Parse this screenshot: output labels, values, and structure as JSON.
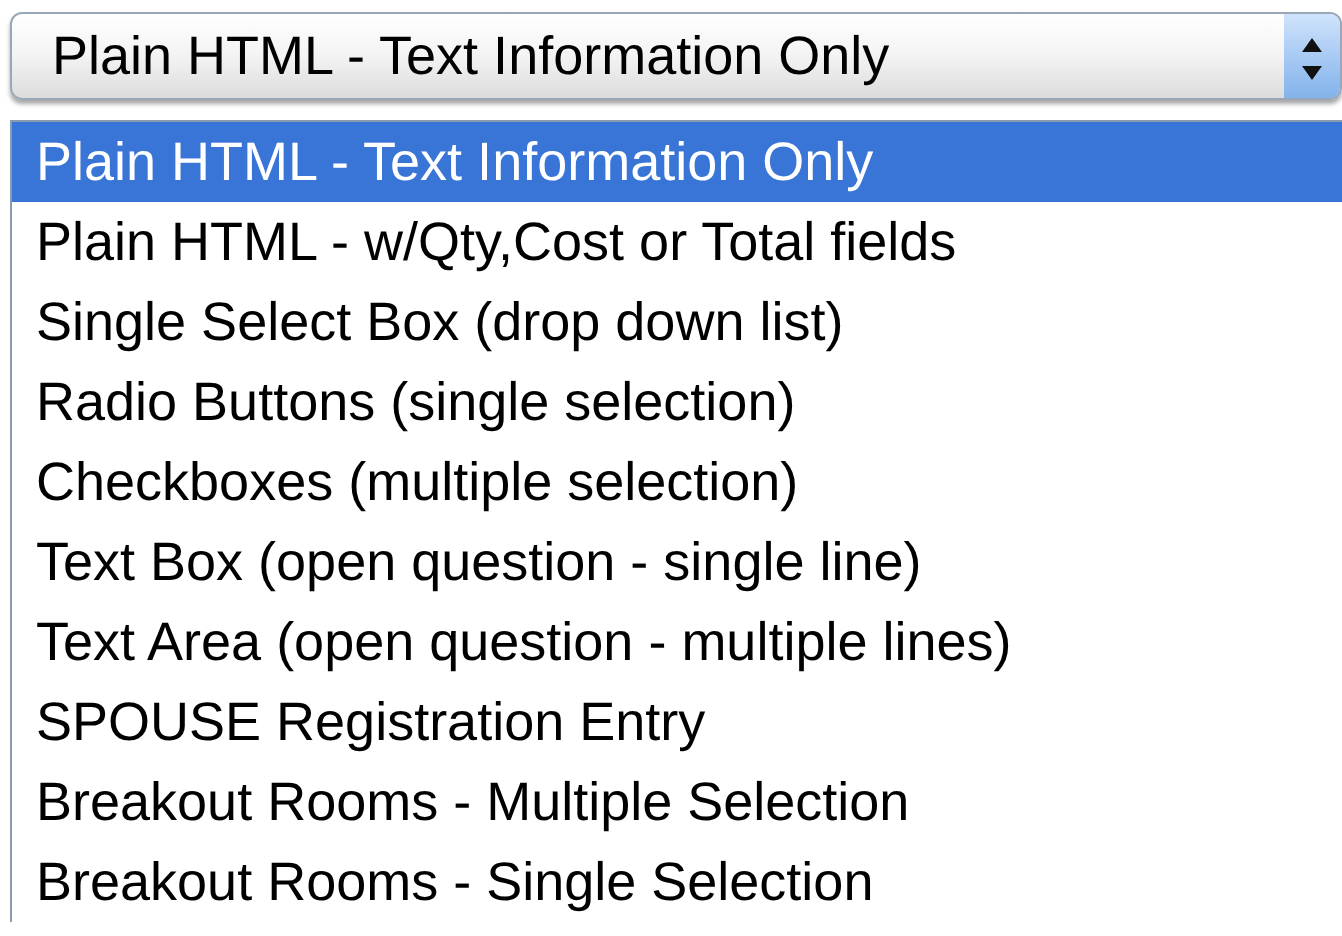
{
  "select": {
    "value": "Plain HTML - Text Information Only"
  },
  "options": [
    {
      "label": "Plain HTML - Text Information Only",
      "selected": true
    },
    {
      "label": "Plain HTML - w/Qty,Cost or Total fields",
      "selected": false
    },
    {
      "label": "Single Select Box (drop down list)",
      "selected": false
    },
    {
      "label": "Radio Buttons (single selection)",
      "selected": false
    },
    {
      "label": "Checkboxes (multiple selection)",
      "selected": false
    },
    {
      "label": "Text Box (open question - single line)",
      "selected": false
    },
    {
      "label": "Text Area (open question - multiple lines)",
      "selected": false
    },
    {
      "label": "SPOUSE Registration Entry",
      "selected": false
    },
    {
      "label": "Breakout Rooms - Multiple Selection",
      "selected": false
    },
    {
      "label": "Breakout Rooms - Single Selection",
      "selected": false
    }
  ]
}
